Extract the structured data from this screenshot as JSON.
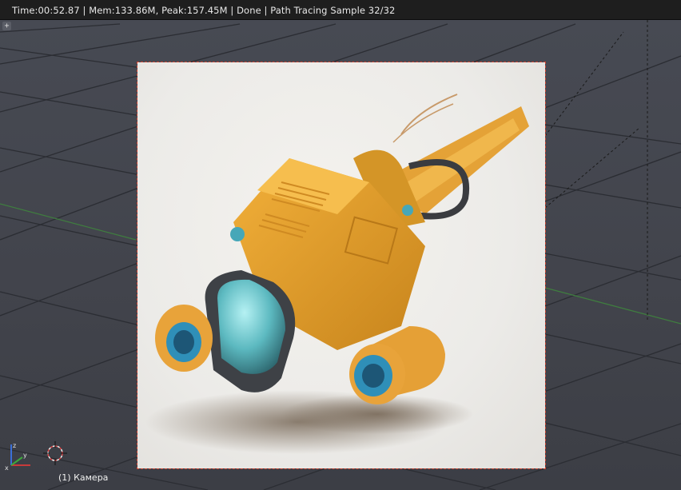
{
  "header": {
    "status_text": "Time:00:52.87 | Mem:133.86M, Peak:157.45M | Done | Path Tracing Sample 32/32"
  },
  "viewport": {
    "object_label": "(1) Камера",
    "expand_button": "+",
    "grid_color": "#2a2c31",
    "accent_color": "#c8402e"
  },
  "icons": {
    "axis_gizmo": "xyz-axis-icon",
    "cursor": "3d-cursor-icon"
  }
}
